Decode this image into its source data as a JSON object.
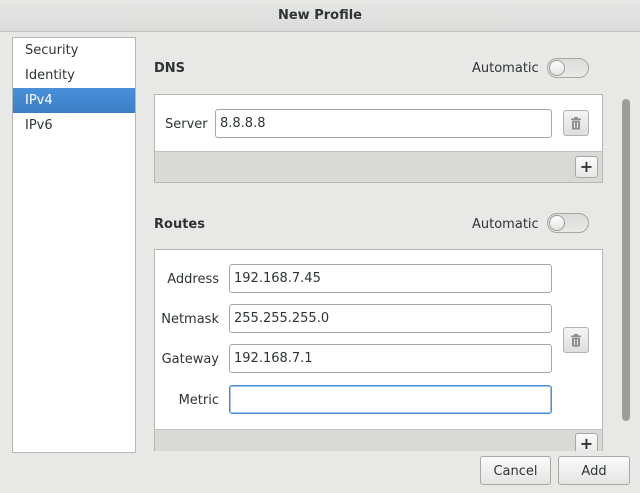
{
  "window": {
    "title": "New Profile"
  },
  "sidebar": {
    "items": [
      {
        "label": "Security",
        "selected": false
      },
      {
        "label": "Identity",
        "selected": false
      },
      {
        "label": "IPv4",
        "selected": true
      },
      {
        "label": "IPv6",
        "selected": false
      }
    ]
  },
  "dns": {
    "title": "DNS",
    "automatic_label": "Automatic",
    "automatic_on": false,
    "server_label": "Server",
    "server_value": "8.8.8.8"
  },
  "routes": {
    "title": "Routes",
    "automatic_label": "Automatic",
    "automatic_on": false,
    "address_label": "Address",
    "address_value": "192.168.7.45",
    "netmask_label": "Netmask",
    "netmask_value": "255.255.255.0",
    "gateway_label": "Gateway",
    "gateway_value": "192.168.7.1",
    "metric_label": "Metric",
    "metric_value": ""
  },
  "buttons": {
    "cancel": "Cancel",
    "add": "Add",
    "plus": "+"
  },
  "icons": {
    "delete": "trash-icon",
    "add": "plus-icon"
  },
  "colors": {
    "accent": "#4a90d9",
    "selected_bg": "#3a7fc6"
  }
}
